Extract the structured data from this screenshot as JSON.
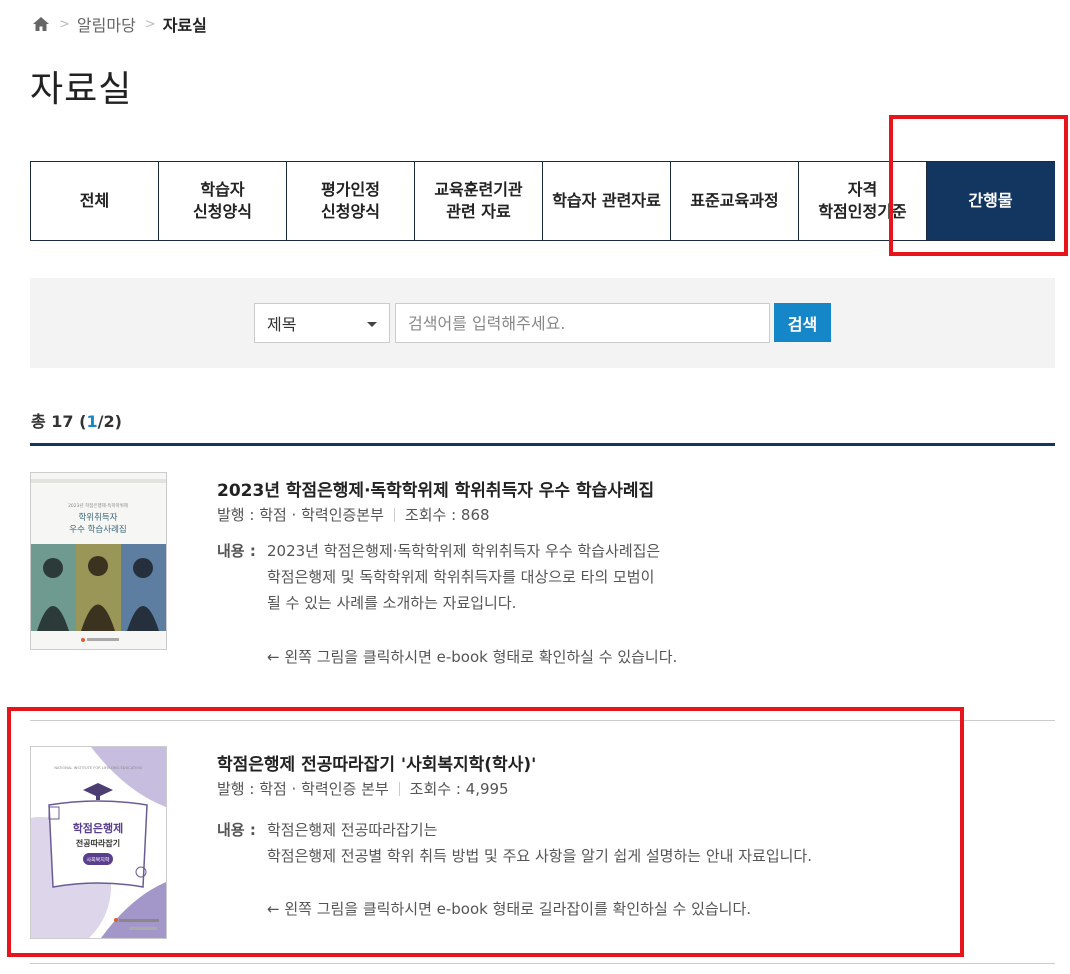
{
  "breadcrumb": {
    "items": [
      "알림마당",
      "자료실"
    ]
  },
  "page_title": "자료실",
  "tabs": [
    {
      "label": "전체"
    },
    {
      "label": "학습자\n신청양식"
    },
    {
      "label": "평가인정\n신청양식"
    },
    {
      "label": "교육훈련기관\n관련 자료"
    },
    {
      "label": "학습자 관련자료"
    },
    {
      "label": "표준교육과정"
    },
    {
      "label": "자격\n학점인정기준"
    },
    {
      "label": "간행물",
      "active": true
    }
  ],
  "search": {
    "select_value": "제목",
    "placeholder": "검색어를 입력해주세요.",
    "button_label": "검색"
  },
  "result": {
    "prefix": "총 17 (",
    "current_page": "1",
    "suffix": "/2)"
  },
  "items": [
    {
      "title": "2023년 학점은행제·독학학위제 학위취득자 우수 학습사례집",
      "publisher": "발행 : 학점 · 학력인증본부",
      "views": "조회수 : 868",
      "content_label": "내용 :",
      "content": "2023년 학점은행제·독학학위제 학위취득자 우수 학습사례집은\n학점은행제 및 독학학위제 학위취득자를 대상으로 타의 모범이\n될 수 있는 사례를 소개하는 자료입니다.",
      "hint": "← 왼쪽 그림을 클릭하시면 e-book 형태로 확인하실 수 있습니다.",
      "cover_text": [
        "2023년 학점은행제·독학학위제",
        "학위취득자",
        "우수 학습사례집"
      ]
    },
    {
      "title": "학점은행제 전공따라잡기 '사회복지학(학사)'",
      "publisher": "발행 : 학점 · 학력인증 본부",
      "views": "조회수 : 4,995",
      "content_label": "내용 :",
      "content": "학점은행제 전공따라잡기는\n학점은행제 전공별 학위 취득 방법 및 주요 사항을 알기 쉽게 설명하는 안내 자료입니다.",
      "hint": "← 왼쪽 그림을 클릭하시면 e-book 형태로 길라잡이를 확인하실 수 있습니다.",
      "cover_text": [
        "학점은행제",
        "전공따라잡기",
        "사회복지학"
      ]
    }
  ],
  "colors": {
    "active_tab": "#12365f",
    "search_button": "#1586c7",
    "highlight": "#e8141b"
  }
}
